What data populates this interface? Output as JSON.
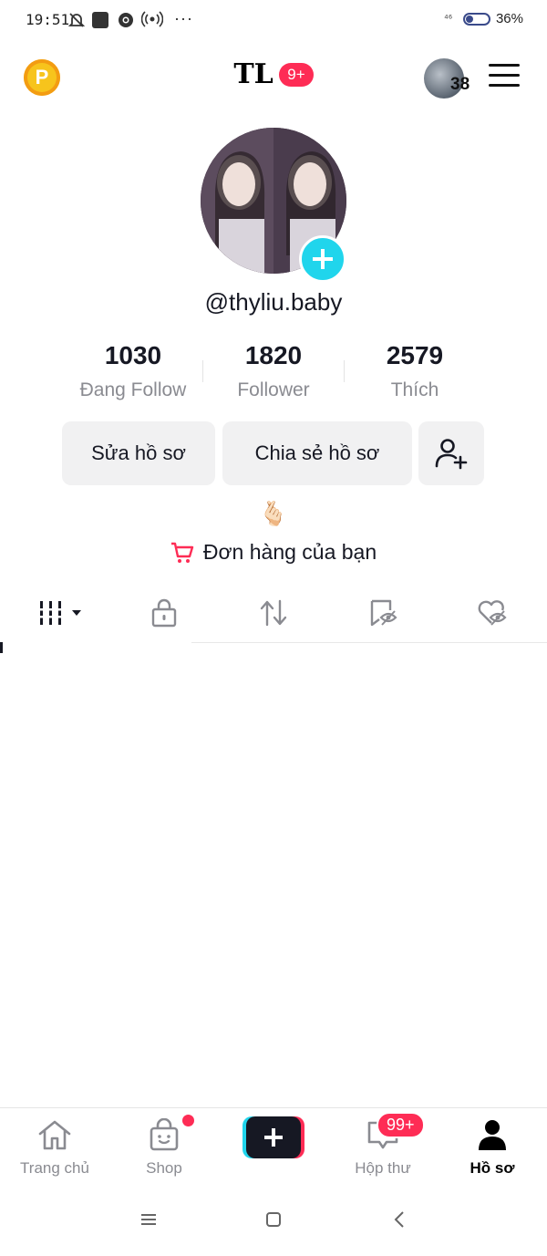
{
  "status_bar": {
    "time": "19:51",
    "icons": [
      "bell-off-icon",
      "app-icon",
      "chrome-icon",
      "hotspot-icon"
    ],
    "more": "···",
    "signal": "⁴⁶",
    "battery": "36%"
  },
  "header": {
    "coin_letter": "P",
    "title": "TL",
    "title_badge": "9+",
    "friends_count": "38"
  },
  "profile": {
    "username": "@thyliu.baby",
    "stats": [
      {
        "value": "1030",
        "label": "Đang Follow"
      },
      {
        "value": "1820",
        "label": "Follower"
      },
      {
        "value": "2579",
        "label": "Thích"
      }
    ],
    "buttons": {
      "edit": "Sửa hồ sơ",
      "share": "Chia sẻ hồ sơ"
    },
    "bio_emoji": "🫰🏻",
    "orders_label": "Đơn hàng của bạn"
  },
  "tabs": [
    "videos-grid-icon",
    "private-lock-icon",
    "repost-icon",
    "favorites-icon",
    "liked-icon"
  ],
  "bottom_nav": {
    "home": "Trang chủ",
    "shop": "Shop",
    "inbox": "Hộp thư",
    "inbox_badge": "99+",
    "profile": "Hồ sơ"
  },
  "colors": {
    "accent_red": "#fe2c55",
    "accent_cyan": "#20d5ec",
    "button_gray": "#f1f1f2",
    "text_gray": "#8a8b91"
  }
}
